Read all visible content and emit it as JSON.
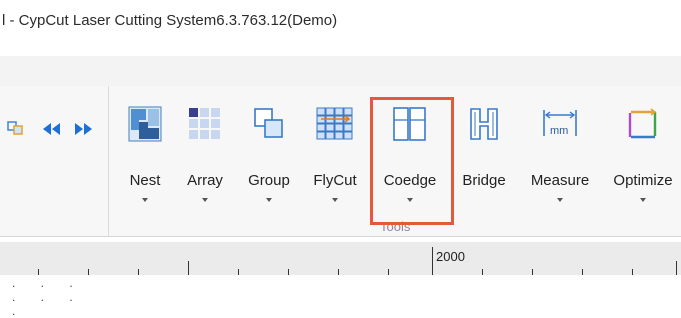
{
  "window": {
    "title": "l - CypCut Laser Cutting System6.3.763.12(Demo)"
  },
  "ribbon": {
    "tools": [
      {
        "label": "Nest",
        "icon": "nest-icon"
      },
      {
        "label": "Array",
        "icon": "array-icon"
      },
      {
        "label": "Group",
        "icon": "group-icon"
      },
      {
        "label": "FlyCut",
        "icon": "flycut-icon"
      },
      {
        "label": "Coedge",
        "icon": "coedge-icon"
      },
      {
        "label": "Bridge",
        "icon": "bridge-icon"
      },
      {
        "label": "Measure",
        "icon": "measure-icon"
      },
      {
        "label": "Optimize",
        "icon": "optimize-icon"
      }
    ],
    "group_label": "Tools",
    "measure_unit": "mm",
    "left_controls": {
      "dots": ". . . . . . ."
    }
  },
  "ruler": {
    "label": "2000"
  },
  "colors": {
    "highlight": "#e4583c",
    "accent_blue": "#1f6fd6"
  }
}
